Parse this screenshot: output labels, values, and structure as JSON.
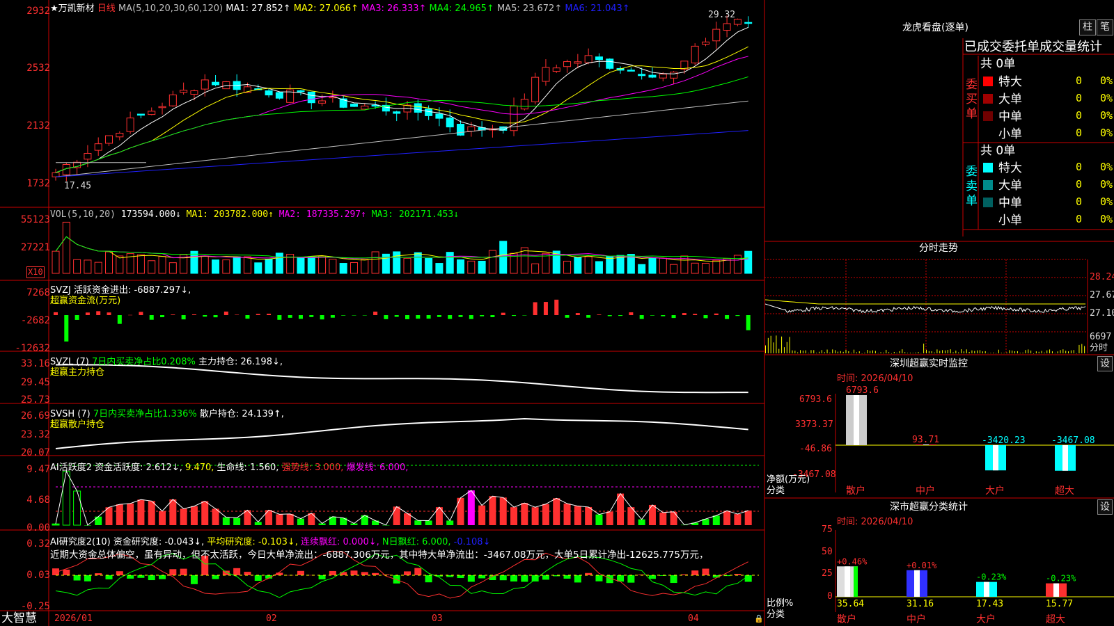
{
  "main": {
    "title": "★万凯新材",
    "period": "日线",
    "ma_label": "MA(5,10,20,30,60,120)",
    "ma_values": [
      "MA1: 27.852↑",
      "MA2: 27.066↑",
      "MA3: 26.333↑",
      "MA4: 24.965↑",
      "MA5: 23.672↑",
      "MA6: 21.043↑"
    ],
    "y_ticks": [
      "2932",
      "2532",
      "2132",
      "1732"
    ],
    "high_label": "29.32",
    "low_label": "17.45"
  },
  "vol": {
    "header": "VOL(5,10,20)",
    "value": "173594.000↓",
    "ma1": "MA1: 203782.000↑",
    "ma2": "MA2: 187335.297↑",
    "ma3": "MA3: 202171.453↓",
    "y_ticks": [
      "55123",
      "27221"
    ],
    "unit": "X10"
  },
  "svzj": {
    "header": "SVZJ  活跃资金进出: -6887.297↓,",
    "subtitle": "超赢资金流(万元)",
    "y_ticks": [
      "7268",
      "-2682",
      "-12632"
    ]
  },
  "svzl": {
    "header_a": "SVZL (7)",
    "header_b": "7日内买卖净占比0.208%",
    "header_c": "主力持仓: 26.198↓,",
    "subtitle": "超赢主力持仓",
    "y_ticks": [
      "33.16",
      "29.45",
      "25.73"
    ]
  },
  "svsh": {
    "header_a": "SVSH (7)",
    "header_b": "7日内买卖净占比1.336%",
    "header_c": "散户持仓: 24.139↑,",
    "subtitle": "超赢散户持仓",
    "y_ticks": [
      "26.69",
      "23.32",
      "20.07"
    ]
  },
  "ai1": {
    "header_a": "AI活跃度2",
    "header_b": "资金活跃度: 2.612↓,",
    "header_c": "9.470,",
    "header_d": "生命线: 1.560,",
    "header_e": "强势线: 3.000,",
    "header_f": "爆发线: 6.000,",
    "y_ticks": [
      "9.47",
      "4.68",
      "0.00"
    ]
  },
  "ai2": {
    "header_a": "AI研究度2(10)",
    "header_b": "资金研究度: -0.043↓,",
    "header_c": "平均研究度: -0.103↓,",
    "header_d": "连续飘红: 0.000↓,",
    "header_e": "N日飘红: 6.000,",
    "header_f": "-0.108↓",
    "commentary": "近期大资金总体偏空，虽有异动，但不太活跃，今日大单净流出：-6887.306万元，其中特大单净流出：-3467.08万元，大单5日累计净出-12625.775万元，",
    "y_ticks": [
      "0.32",
      "0.03",
      "-0.25"
    ]
  },
  "footer": {
    "brand": "大智慧",
    "dates": [
      "2026/01",
      "02",
      "03",
      "04"
    ]
  },
  "right": {
    "dragon_title": "龙虎看盘(逐单)",
    "btn_bar": "柱",
    "btn_pen": "笔",
    "col_header": "已成交委托单成交量统计",
    "buy_label": "委买单",
    "sell_label": "委卖单",
    "buy_total": "共 0单",
    "sell_total": "共 0单",
    "buy_rows": [
      {
        "name": "特大",
        "count": "0",
        "pct": "0%",
        "color": "#ff0000"
      },
      {
        "name": "大单",
        "count": "0",
        "pct": "0%",
        "color": "#a00000"
      },
      {
        "name": "中单",
        "count": "0",
        "pct": "0%",
        "color": "#700000"
      },
      {
        "name": "小单",
        "count": "0",
        "pct": "0%",
        "color": ""
      }
    ],
    "sell_rows": [
      {
        "name": "特大",
        "count": "0",
        "pct": "0%",
        "color": "#00ffff"
      },
      {
        "name": "大单",
        "count": "0",
        "pct": "0%",
        "color": "#008b8b"
      },
      {
        "name": "中单",
        "count": "0",
        "pct": "0%",
        "color": "#006060"
      },
      {
        "name": "小单",
        "count": "0",
        "pct": "0%",
        "color": ""
      }
    ],
    "intraday_title": "分时走势",
    "intraday_prices": [
      "28.24",
      "27.67",
      "27.10"
    ],
    "intraday_vol": "6697",
    "intraday_vol_label": "分时",
    "monitor_title": "深圳超赢实时监控",
    "monitor_btn": "设",
    "monitor_time": "时间: 2026/04/10",
    "monitor_ticks": [
      "6793.6",
      "3373.37",
      "-46.86",
      "-3467.08"
    ],
    "monitor_axis_label_a": "净额(万元)",
    "monitor_axis_label_b": "分类",
    "stats_title": "深市超赢分类统计",
    "stats_btn": "设",
    "stats_time": "时间: 2026/04/10",
    "stats_ticks": [
      "75",
      "50",
      "25",
      "0"
    ],
    "stats_axis_label_a": "比例%",
    "stats_axis_label_b": "分类"
  },
  "monitor_data": {
    "categories": [
      "散户",
      "中户",
      "大户",
      "超大"
    ],
    "values": [
      6793.6,
      93.71,
      -3420.23,
      -3467.08
    ],
    "labels": [
      "6793.6",
      "93.71",
      "-3420.23",
      "-3467.08"
    ]
  },
  "stats_data": {
    "categories": [
      "散户",
      "中户",
      "大户",
      "超大"
    ],
    "values": [
      35.64,
      31.16,
      17.43,
      15.77
    ],
    "labels": [
      "35.64",
      "31.16",
      "17.43",
      "15.77"
    ],
    "changes": [
      "+0.46%",
      "+0.01%",
      "-0.23%",
      "-0.23%"
    ]
  },
  "colors": {
    "up": "#ff3030",
    "down": "#00ffff",
    "grid": "#cc0000",
    "ma1": "#ffffff",
    "ma2": "#ffff00",
    "ma3": "#ff00ff",
    "ma4": "#00ff00",
    "ma5": "#c0c0c0",
    "ma6": "#2020ff"
  }
}
